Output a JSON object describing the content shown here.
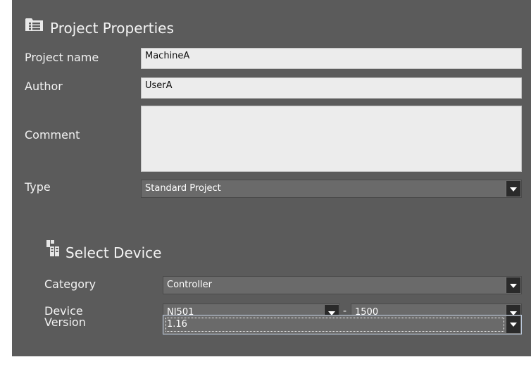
{
  "project": {
    "title": "Project Properties",
    "name_label": "Project name",
    "name_value": "MachineA",
    "author_label": "Author",
    "author_value": "UserA",
    "comment_label": "Comment",
    "comment_value": "",
    "type_label": "Type",
    "type_value": "Standard Project"
  },
  "device": {
    "title": "Select Device",
    "category_label": "Category",
    "category_value": "Controller",
    "device_label": "Device",
    "device_model": "NJ501",
    "device_separator": "-",
    "device_variant": "1500",
    "version_label": "Version",
    "version_value": "1.16"
  },
  "icons": {
    "project": "list-folder-icon",
    "device": "device-rack-icon"
  },
  "colors": {
    "panel_bg": "#5b5b5b",
    "field_bg": "#ececec",
    "combo_bg": "#6a6a6a",
    "dropdown_button": "#2a2a2a"
  }
}
